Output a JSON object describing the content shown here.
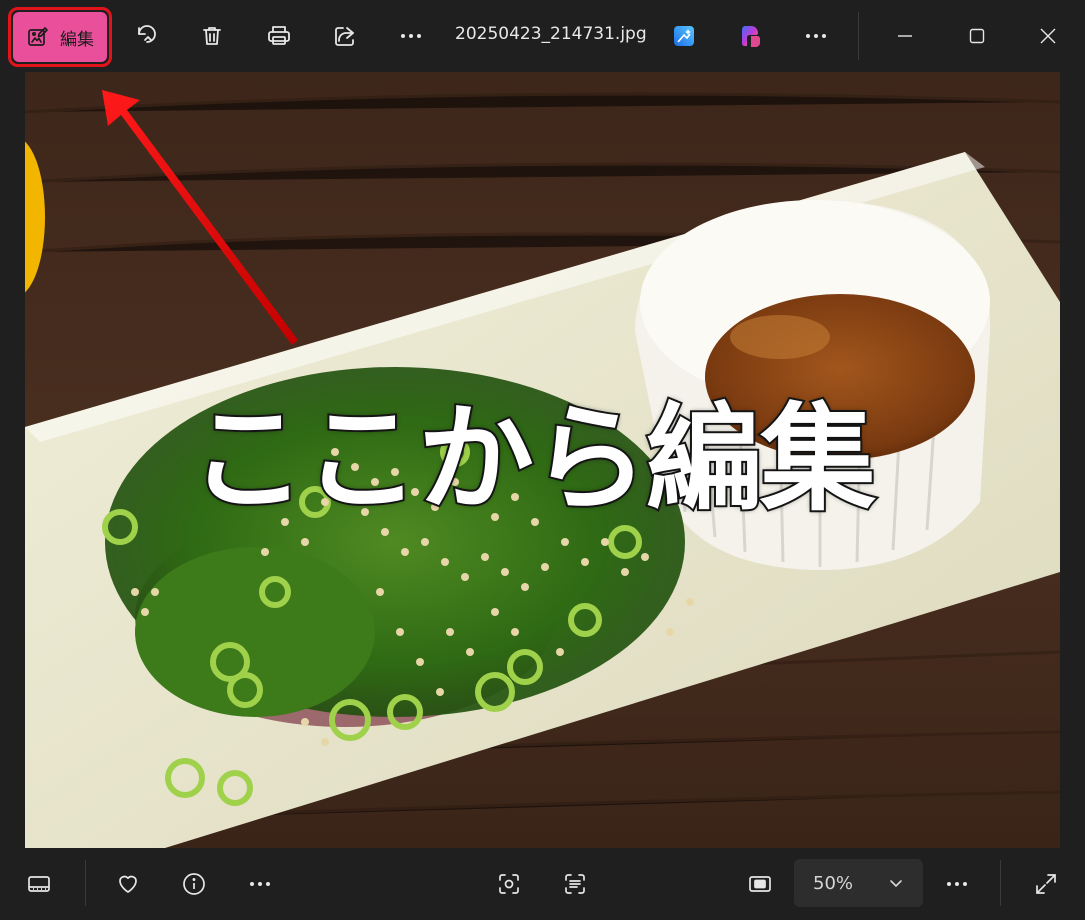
{
  "toolbar": {
    "edit_label": "編集",
    "filename": "20250423_214731.jpg",
    "icons": [
      "edit-icon",
      "rotate-icon",
      "delete-icon",
      "print-icon",
      "share-icon",
      "more-icon",
      "designer-icon",
      "copilot-icon",
      "more-icon"
    ]
  },
  "window": {
    "controls": [
      "minimize-icon",
      "maximize-icon",
      "close-icon"
    ]
  },
  "photo": {
    "overlay_text": "ここから編集",
    "annotation_color": "#e1141c"
  },
  "bottombar": {
    "icons": [
      "filmstrip-icon",
      "favorite-icon",
      "info-icon",
      "more-icon",
      "visual-search-icon",
      "text-scan-icon",
      "actual-size-icon",
      "more-icon",
      "fullscreen-icon"
    ],
    "zoom_value": "50%"
  },
  "colors": {
    "accent": "#ea4f9b",
    "highlight_border": "#e1141c",
    "background": "#1f1f1f"
  }
}
